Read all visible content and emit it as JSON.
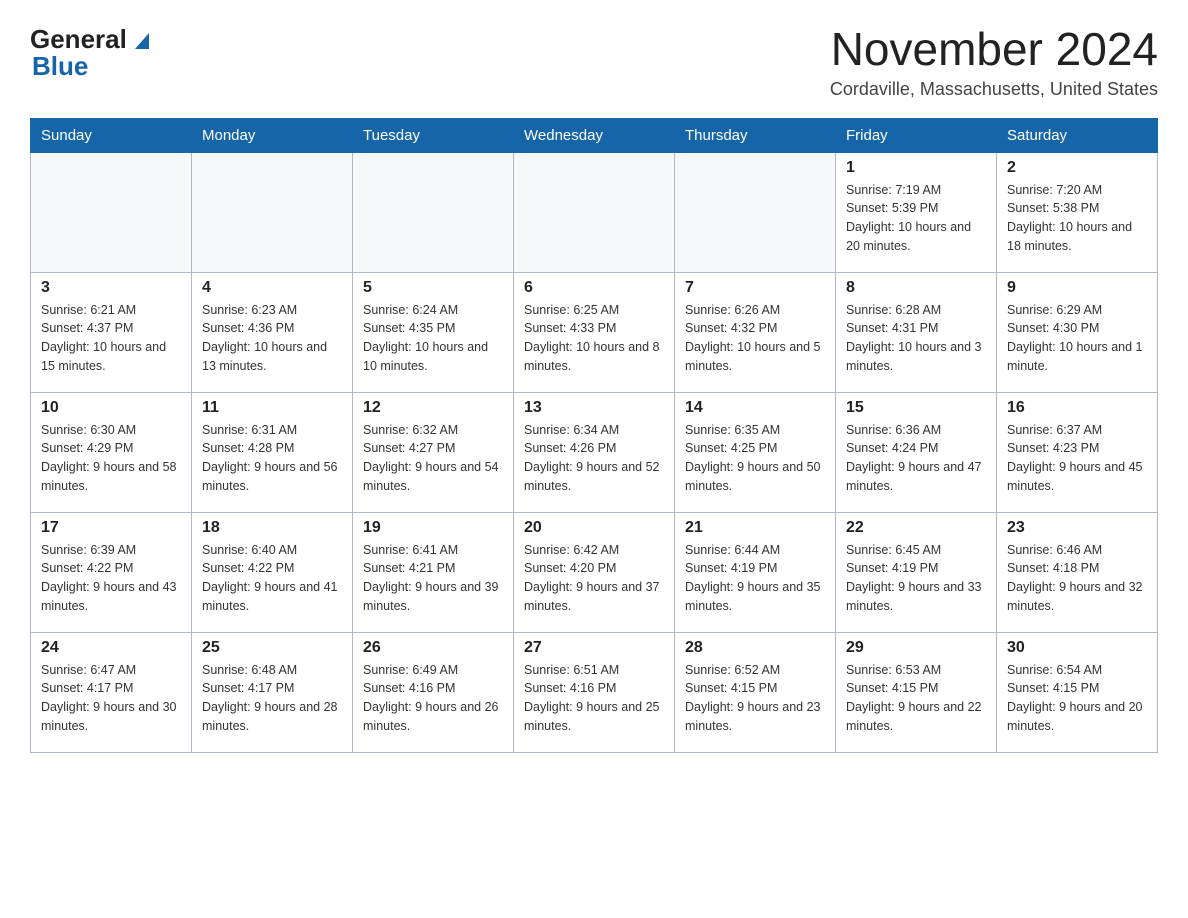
{
  "header": {
    "logo_general": "General",
    "logo_blue": "Blue",
    "month_title": "November 2024",
    "location": "Cordaville, Massachusetts, United States"
  },
  "weekdays": [
    "Sunday",
    "Monday",
    "Tuesday",
    "Wednesday",
    "Thursday",
    "Friday",
    "Saturday"
  ],
  "weeks": [
    [
      {
        "day": "",
        "info": ""
      },
      {
        "day": "",
        "info": ""
      },
      {
        "day": "",
        "info": ""
      },
      {
        "day": "",
        "info": ""
      },
      {
        "day": "",
        "info": ""
      },
      {
        "day": "1",
        "info": "Sunrise: 7:19 AM\nSunset: 5:39 PM\nDaylight: 10 hours and 20 minutes."
      },
      {
        "day": "2",
        "info": "Sunrise: 7:20 AM\nSunset: 5:38 PM\nDaylight: 10 hours and 18 minutes."
      }
    ],
    [
      {
        "day": "3",
        "info": "Sunrise: 6:21 AM\nSunset: 4:37 PM\nDaylight: 10 hours and 15 minutes."
      },
      {
        "day": "4",
        "info": "Sunrise: 6:23 AM\nSunset: 4:36 PM\nDaylight: 10 hours and 13 minutes."
      },
      {
        "day": "5",
        "info": "Sunrise: 6:24 AM\nSunset: 4:35 PM\nDaylight: 10 hours and 10 minutes."
      },
      {
        "day": "6",
        "info": "Sunrise: 6:25 AM\nSunset: 4:33 PM\nDaylight: 10 hours and 8 minutes."
      },
      {
        "day": "7",
        "info": "Sunrise: 6:26 AM\nSunset: 4:32 PM\nDaylight: 10 hours and 5 minutes."
      },
      {
        "day": "8",
        "info": "Sunrise: 6:28 AM\nSunset: 4:31 PM\nDaylight: 10 hours and 3 minutes."
      },
      {
        "day": "9",
        "info": "Sunrise: 6:29 AM\nSunset: 4:30 PM\nDaylight: 10 hours and 1 minute."
      }
    ],
    [
      {
        "day": "10",
        "info": "Sunrise: 6:30 AM\nSunset: 4:29 PM\nDaylight: 9 hours and 58 minutes."
      },
      {
        "day": "11",
        "info": "Sunrise: 6:31 AM\nSunset: 4:28 PM\nDaylight: 9 hours and 56 minutes."
      },
      {
        "day": "12",
        "info": "Sunrise: 6:32 AM\nSunset: 4:27 PM\nDaylight: 9 hours and 54 minutes."
      },
      {
        "day": "13",
        "info": "Sunrise: 6:34 AM\nSunset: 4:26 PM\nDaylight: 9 hours and 52 minutes."
      },
      {
        "day": "14",
        "info": "Sunrise: 6:35 AM\nSunset: 4:25 PM\nDaylight: 9 hours and 50 minutes."
      },
      {
        "day": "15",
        "info": "Sunrise: 6:36 AM\nSunset: 4:24 PM\nDaylight: 9 hours and 47 minutes."
      },
      {
        "day": "16",
        "info": "Sunrise: 6:37 AM\nSunset: 4:23 PM\nDaylight: 9 hours and 45 minutes."
      }
    ],
    [
      {
        "day": "17",
        "info": "Sunrise: 6:39 AM\nSunset: 4:22 PM\nDaylight: 9 hours and 43 minutes."
      },
      {
        "day": "18",
        "info": "Sunrise: 6:40 AM\nSunset: 4:22 PM\nDaylight: 9 hours and 41 minutes."
      },
      {
        "day": "19",
        "info": "Sunrise: 6:41 AM\nSunset: 4:21 PM\nDaylight: 9 hours and 39 minutes."
      },
      {
        "day": "20",
        "info": "Sunrise: 6:42 AM\nSunset: 4:20 PM\nDaylight: 9 hours and 37 minutes."
      },
      {
        "day": "21",
        "info": "Sunrise: 6:44 AM\nSunset: 4:19 PM\nDaylight: 9 hours and 35 minutes."
      },
      {
        "day": "22",
        "info": "Sunrise: 6:45 AM\nSunset: 4:19 PM\nDaylight: 9 hours and 33 minutes."
      },
      {
        "day": "23",
        "info": "Sunrise: 6:46 AM\nSunset: 4:18 PM\nDaylight: 9 hours and 32 minutes."
      }
    ],
    [
      {
        "day": "24",
        "info": "Sunrise: 6:47 AM\nSunset: 4:17 PM\nDaylight: 9 hours and 30 minutes."
      },
      {
        "day": "25",
        "info": "Sunrise: 6:48 AM\nSunset: 4:17 PM\nDaylight: 9 hours and 28 minutes."
      },
      {
        "day": "26",
        "info": "Sunrise: 6:49 AM\nSunset: 4:16 PM\nDaylight: 9 hours and 26 minutes."
      },
      {
        "day": "27",
        "info": "Sunrise: 6:51 AM\nSunset: 4:16 PM\nDaylight: 9 hours and 25 minutes."
      },
      {
        "day": "28",
        "info": "Sunrise: 6:52 AM\nSunset: 4:15 PM\nDaylight: 9 hours and 23 minutes."
      },
      {
        "day": "29",
        "info": "Sunrise: 6:53 AM\nSunset: 4:15 PM\nDaylight: 9 hours and 22 minutes."
      },
      {
        "day": "30",
        "info": "Sunrise: 6:54 AM\nSunset: 4:15 PM\nDaylight: 9 hours and 20 minutes."
      }
    ]
  ]
}
